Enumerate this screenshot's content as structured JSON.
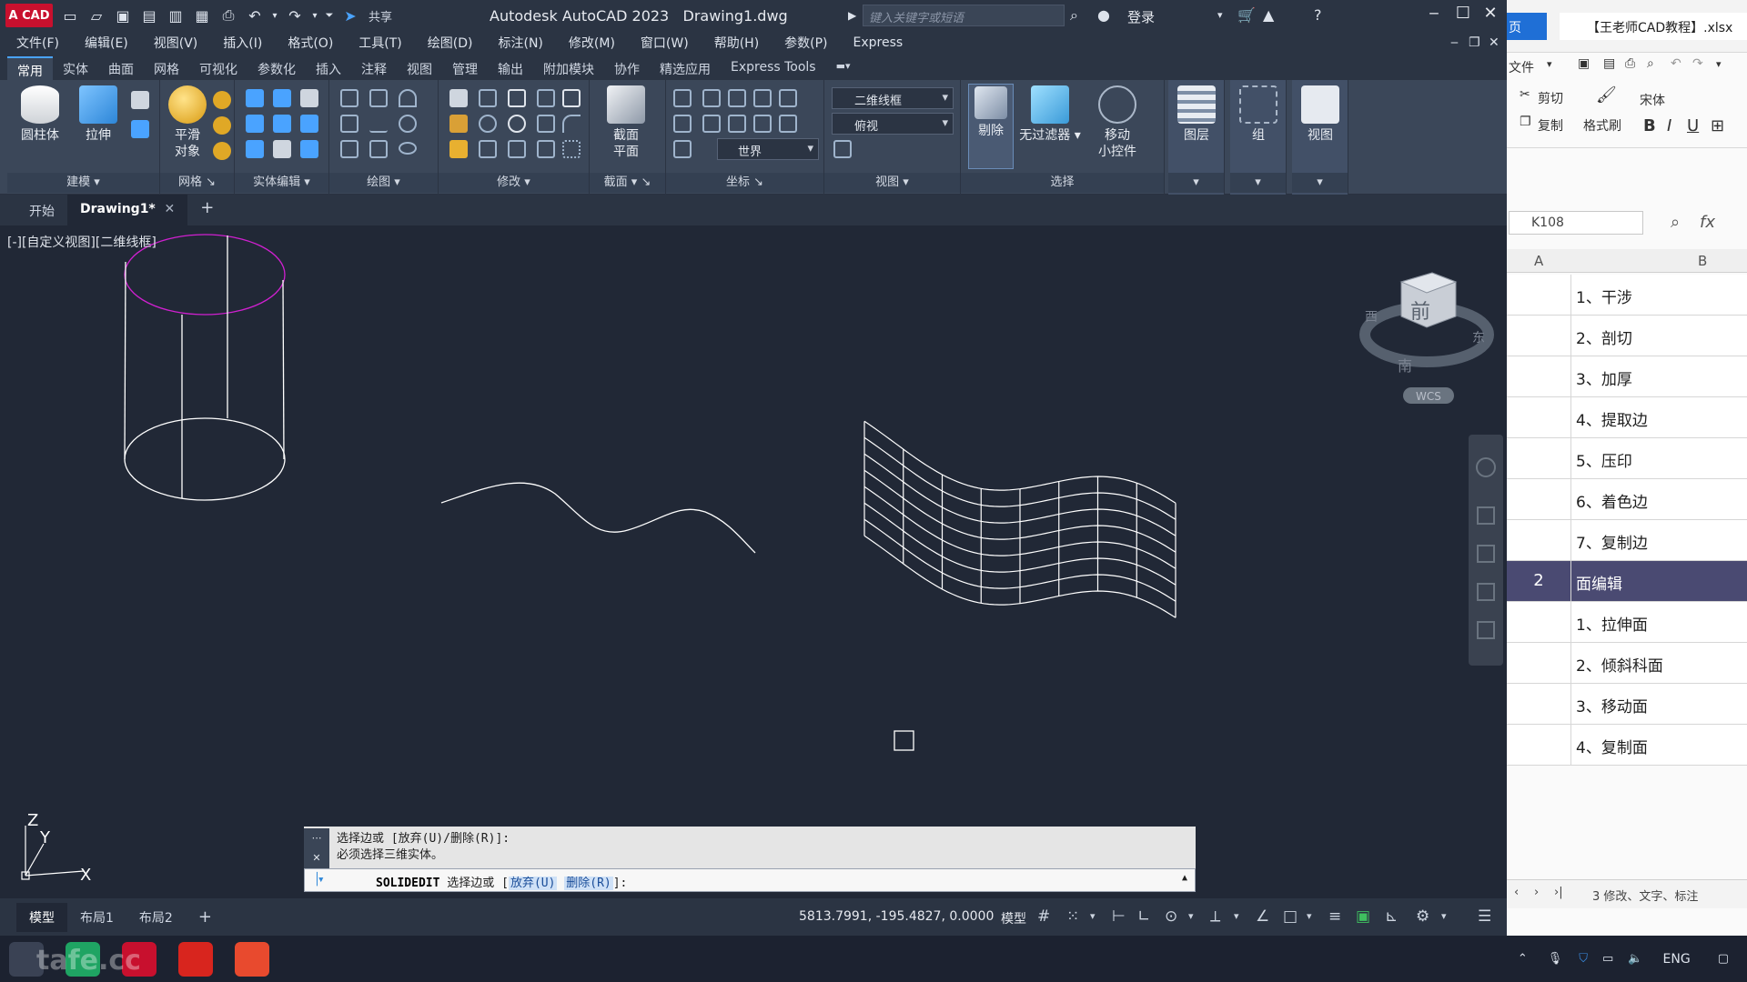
{
  "acad": {
    "logo": "A CAD",
    "share": "共享",
    "title": "Autodesk AutoCAD 2023",
    "drawing_file": "Drawing1.dwg",
    "search_placeholder": "键入关键字或短语",
    "login": "登录",
    "menus": [
      "文件(F)",
      "编辑(E)",
      "视图(V)",
      "插入(I)",
      "格式(O)",
      "工具(T)",
      "绘图(D)",
      "标注(N)",
      "修改(M)",
      "窗口(W)",
      "帮助(H)",
      "参数(P)",
      "Express"
    ],
    "ribbon_tabs": [
      "常用",
      "实体",
      "曲面",
      "网格",
      "可视化",
      "参数化",
      "插入",
      "注释",
      "视图",
      "管理",
      "输出",
      "附加模块",
      "协作",
      "精选应用",
      "Express Tools"
    ],
    "active_ribbon_tab": "常用",
    "panels": {
      "modeling": "建模",
      "mesh": "网格",
      "solid_edit": "实体编辑",
      "draw": "绘图",
      "modify": "修改",
      "section": "截面",
      "coords": "坐标",
      "view": "视图",
      "selection": "选择"
    },
    "big_buttons": {
      "cylinder": "圆柱体",
      "extrude": "拉伸",
      "smooth1": "平滑",
      "smooth2": "对象",
      "section1": "截面",
      "section2": "平面",
      "cull": "剔除",
      "nofilter": "无过滤器",
      "gizmo1": "移动",
      "gizmo2": "小控件",
      "layers": "图层",
      "group": "组",
      "views": "视图"
    },
    "visual_style": "二维线框",
    "view_dir": "俯视",
    "ucs": "世界",
    "doc_tabs": [
      "开始",
      "Drawing1*"
    ],
    "viewport_label": "[-][自定义视图][二维线框]",
    "viewcube": {
      "face": "前",
      "west": "西",
      "east": "东",
      "south": "南",
      "wcs": "WCS"
    },
    "ucs_axes": {
      "x": "X",
      "y": "Y",
      "z": "Z"
    },
    "cmd_history": [
      "选择边或 [放弃(U)/删除(R)]:",
      "必须选择三维实体。"
    ],
    "cmd_name": "SOLIDEDIT",
    "cmd_prompt": "选择边或 [",
    "cmd_opt1": "放弃(U)",
    "cmd_opt2": "删除(R)",
    "cmd_end": "]:",
    "layout_tabs": [
      "模型",
      "布局1",
      "布局2"
    ],
    "coords": "5813.7991, -195.4827, 0.0000",
    "model_label": "模型"
  },
  "excel": {
    "prev_tab": "页",
    "file_tab": "【王老师CAD教程】.xlsx",
    "file_menu": "文件",
    "cut": "剪切",
    "copy": "复制",
    "format_painter": "格式刷",
    "font": "宋体",
    "namebox": "K108",
    "fx": "fx",
    "col_a": "A",
    "col_b": "B",
    "rows": [
      {
        "a": "",
        "b": "1、干涉"
      },
      {
        "a": "",
        "b": "2、剖切"
      },
      {
        "a": "",
        "b": "3、加厚"
      },
      {
        "a": "",
        "b": "4、提取边"
      },
      {
        "a": "",
        "b": "5、压印"
      },
      {
        "a": "",
        "b": "6、着色边"
      },
      {
        "a": "",
        "b": "7、复制边"
      },
      {
        "a": "2",
        "b": "面编辑",
        "selected": true
      },
      {
        "a": "",
        "b": "1、拉伸面"
      },
      {
        "a": "",
        "b": "2、倾斜科面"
      },
      {
        "a": "",
        "b": "3、移动面"
      },
      {
        "a": "",
        "b": "4、复制面"
      }
    ],
    "sheet_tab": "3 修改、文字、标注"
  },
  "taskbar": {
    "lang": "ENG",
    "watermark": "tafe.cc"
  },
  "colors": {
    "accent": "#4aa3ff",
    "cylinder_top": "#d020d0",
    "autocad_red": "#c8102e"
  }
}
